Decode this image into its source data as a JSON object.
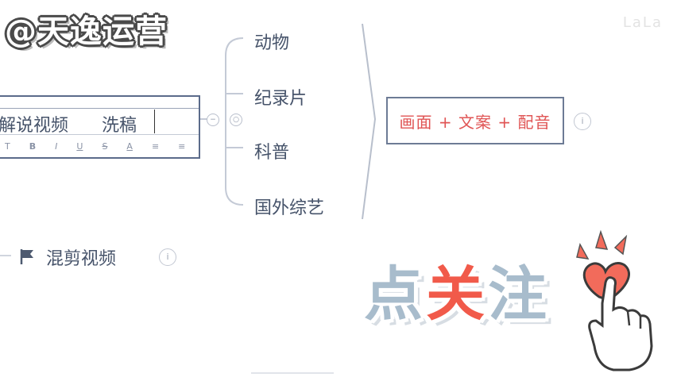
{
  "watermark": {
    "text": "@天逸运营"
  },
  "corner_mark": {
    "text": "LaLa"
  },
  "editor": {
    "text_left": "解说视频",
    "text_right": "洗稿",
    "toolbar": [
      "T",
      "B",
      "I",
      "U",
      "S",
      "A",
      "≡",
      "≡"
    ]
  },
  "branches": {
    "items": [
      "动物",
      "纪录片",
      "科普",
      "国外综艺"
    ]
  },
  "right_node": {
    "text": "画面 + 文案 + 配音"
  },
  "mix": {
    "label": "混剪视频"
  },
  "sticker": {
    "chars": [
      "点",
      "关",
      "注"
    ],
    "colors": {
      "char1": "#a8bccc",
      "char2": "#f15a4a",
      "char3": "#a8bccc",
      "heart": "#f26b5b"
    }
  },
  "icons": {
    "collapse": "collapse-icon",
    "info": "info-icon",
    "flag": "flag-icon",
    "hand": "pointing-hand-icon",
    "heart": "heart-icon"
  }
}
